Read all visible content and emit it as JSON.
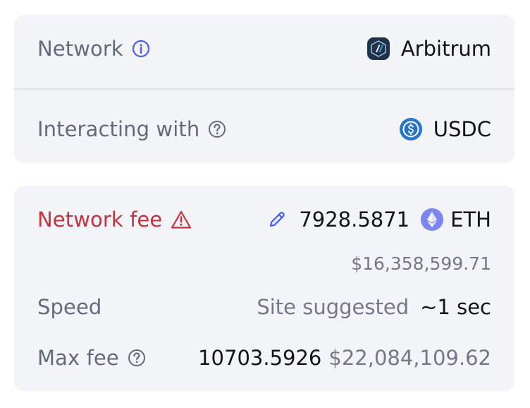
{
  "transaction": {
    "network_label": "Network",
    "network_value": "Arbitrum",
    "interacting_label": "Interacting with",
    "interacting_value": "USDC"
  },
  "fee": {
    "network_fee_label": "Network fee",
    "amount": "7928.5871",
    "currency": "ETH",
    "usd_value": "$16,358,599.71",
    "speed_label": "Speed",
    "speed_source": "Site suggested",
    "speed_value": "~1 sec",
    "max_fee_label": "Max fee",
    "max_fee_amount": "10703.5926",
    "max_fee_usd": "$22,084,109.62"
  },
  "icons": {
    "network_info": "info-icon",
    "interacting_help": "question-icon",
    "fee_warning": "warning-icon",
    "edit_fee": "pencil-icon",
    "eth_token": "ethereum-icon",
    "usdc_token": "usdc-icon",
    "arbitrum_logo": "arbitrum-icon",
    "max_fee_help": "question-icon"
  },
  "colors": {
    "card_bg": "#f3f4f8",
    "label": "#636b7a",
    "value": "#121318",
    "accent": "#4a5cf5",
    "danger": "#c4323e",
    "usdc_blue": "#2775ca",
    "eth_purple": "#7b86ef",
    "arbitrum_dark": "#213147"
  }
}
